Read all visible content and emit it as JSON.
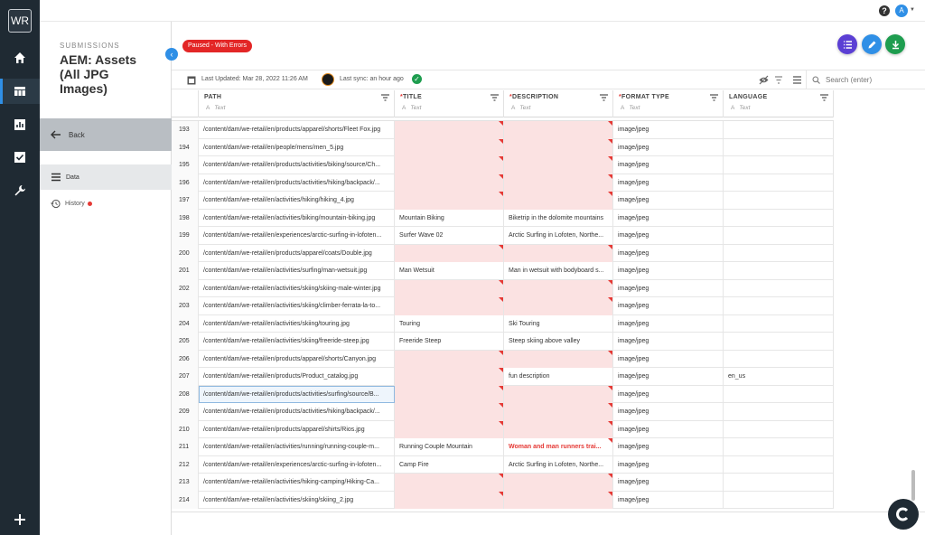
{
  "rail": {
    "logo": "WR",
    "icons": [
      "home-icon",
      "table-icon",
      "chart-icon",
      "checklist-icon",
      "wrench-icon",
      "plus-icon"
    ]
  },
  "topbar": {
    "help": "?",
    "avatar": "A"
  },
  "sidebar": {
    "section_label": "SUBMISSIONS",
    "title": "AEM: Assets (All JPG Images)",
    "back_label": "Back",
    "nav": [
      {
        "label": "Data",
        "icon": "list-icon",
        "active": true
      },
      {
        "label": "History",
        "icon": "history-icon",
        "has_alert_dot": true
      }
    ]
  },
  "status_badge": "Paused - With Errors",
  "infobar": {
    "last_updated": "Last Updated: Mar 28, 2022 11:26 AM",
    "last_sync": "Last sync: an hour ago",
    "search_placeholder": "Search (enter)"
  },
  "colors": {
    "rail_bg": "#1f2a33",
    "accent": "#2f8fe6",
    "error": "#e53935",
    "error_cell_bg": "#fbe2e2",
    "fab_list": "#5b3fd4",
    "fab_edit": "#2f8fe6",
    "fab_download": "#1e9d4f"
  },
  "grid": {
    "columns": [
      {
        "label": "PATH",
        "required": false,
        "type_label": "Text"
      },
      {
        "label": "TITLE",
        "required": true,
        "type_label": "Text"
      },
      {
        "label": "DESCRIPTION",
        "required": true,
        "type_label": "Text"
      },
      {
        "label": "FORMAT TYPE",
        "required": true,
        "type_label": "Text"
      },
      {
        "label": "LANGUAGE",
        "required": false,
        "type_label": "Text"
      }
    ],
    "rows": [
      {
        "n": "193",
        "path": "/content/dam/we-retail/en/products/apparel/shorts/Fleet Fox.jpg",
        "title": "",
        "desc": "",
        "fmt": "image/jpeg",
        "lang": ""
      },
      {
        "n": "194",
        "path": "/content/dam/we-retail/en/people/mens/men_5.jpg",
        "title": "",
        "desc": "",
        "fmt": "image/jpeg",
        "lang": ""
      },
      {
        "n": "195",
        "path": "/content/dam/we-retail/en/products/activities/biking/source/Ch...",
        "title": "",
        "desc": "",
        "fmt": "image/jpeg",
        "lang": ""
      },
      {
        "n": "196",
        "path": "/content/dam/we-retail/en/products/activities/hiking/backpack/...",
        "title": "",
        "desc": "",
        "fmt": "image/jpeg",
        "lang": ""
      },
      {
        "n": "197",
        "path": "/content/dam/we-retail/en/activities/hiking/hiking_4.jpg",
        "title": "",
        "desc": "",
        "fmt": "image/jpeg",
        "lang": ""
      },
      {
        "n": "198",
        "path": "/content/dam/we-retail/en/activities/biking/mountain-biking.jpg",
        "title": "Mountain Biking",
        "desc": "Biketrip in the dolomite mountains",
        "fmt": "image/jpeg",
        "lang": ""
      },
      {
        "n": "199",
        "path": "/content/dam/we-retail/en/experiences/arctic-surfing-in-lofoten...",
        "title": "Surfer Wave 02",
        "desc": "Arctic Surfing in Lofoten, Northe...",
        "fmt": "image/jpeg",
        "lang": ""
      },
      {
        "n": "200",
        "path": "/content/dam/we-retail/en/products/apparel/coats/Double.jpg",
        "title": "",
        "desc": "",
        "fmt": "image/jpeg",
        "lang": ""
      },
      {
        "n": "201",
        "path": "/content/dam/we-retail/en/activities/surfing/man-wetsuit.jpg",
        "title": "Man Wetsuit",
        "desc": "Man in wetsuit with bodyboard s...",
        "fmt": "image/jpeg",
        "lang": ""
      },
      {
        "n": "202",
        "path": "/content/dam/we-retail/en/activities/skiing/skiing-male-winter.jpg",
        "title": "",
        "desc": "",
        "fmt": "image/jpeg",
        "lang": ""
      },
      {
        "n": "203",
        "path": "/content/dam/we-retail/en/activities/skiing/climber-ferrata-la-to...",
        "title": "",
        "desc": "",
        "fmt": "image/jpeg",
        "lang": ""
      },
      {
        "n": "204",
        "path": "/content/dam/we-retail/en/activities/skiing/touring.jpg",
        "title": "Touring",
        "desc": "Ski Touring",
        "fmt": "image/jpeg",
        "lang": ""
      },
      {
        "n": "205",
        "path": "/content/dam/we-retail/en/activities/skiing/freeride-steep.jpg",
        "title": "Freeride Steep",
        "desc": "Steep skiing above valley",
        "fmt": "image/jpeg",
        "lang": ""
      },
      {
        "n": "206",
        "path": "/content/dam/we-retail/en/products/apparel/shorts/Canyon.jpg",
        "title": "",
        "desc": "",
        "fmt": "image/jpeg",
        "lang": ""
      },
      {
        "n": "207",
        "path": "/content/dam/we-retail/en/products/Product_catalog.jpg",
        "title": "",
        "desc": "fun description",
        "fmt": "image/jpeg",
        "lang": "en_us"
      },
      {
        "n": "208",
        "path": "/content/dam/we-retail/en/products/activities/surfing/source/B...",
        "title": "",
        "desc": "",
        "fmt": "image/jpeg",
        "lang": "",
        "selected": true
      },
      {
        "n": "209",
        "path": "/content/dam/we-retail/en/products/activities/hiking/backpack/...",
        "title": "",
        "desc": "",
        "fmt": "image/jpeg",
        "lang": ""
      },
      {
        "n": "210",
        "path": "/content/dam/we-retail/en/products/apparel/shirts/Rios.jpg",
        "title": "",
        "desc": "",
        "fmt": "image/jpeg",
        "lang": ""
      },
      {
        "n": "211",
        "path": "/content/dam/we-retail/en/activities/running/running-couple-m...",
        "title": "Running Couple Mountain",
        "desc": "Woman and man runners trai...",
        "fmt": "image/jpeg",
        "lang": "",
        "desc_flag": true
      },
      {
        "n": "212",
        "path": "/content/dam/we-retail/en/experiences/arctic-surfing-in-lofoten...",
        "title": "Camp Fire",
        "desc": "Arctic Surfing in Lofoten, Northe...",
        "fmt": "image/jpeg",
        "lang": ""
      },
      {
        "n": "213",
        "path": "/content/dam/we-retail/en/activities/hiking-camping/Hiking-Ca...",
        "title": "",
        "desc": "",
        "fmt": "image/jpeg",
        "lang": ""
      },
      {
        "n": "214",
        "path": "/content/dam/we-retail/en/activities/skiing/skiing_2.jpg",
        "title": "",
        "desc": "",
        "fmt": "image/jpeg",
        "lang": ""
      }
    ]
  }
}
